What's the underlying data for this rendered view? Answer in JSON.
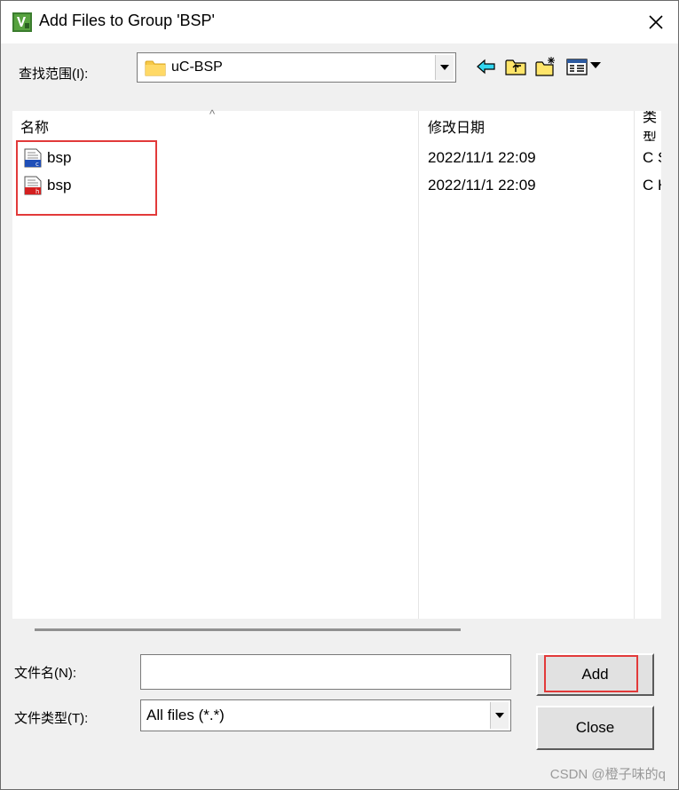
{
  "dialog": {
    "title": "Add Files to Group 'BSP'",
    "app_icon": "keil-uvision-icon",
    "close_icon": "close-icon"
  },
  "lookin": {
    "label": "查找范围(I):",
    "value": "uC-BSP",
    "folder_icon": "folder-icon",
    "toolbar": [
      "back-arrow-icon",
      "up-folder-icon",
      "new-folder-icon",
      "view-menu-icon"
    ]
  },
  "list": {
    "columns": [
      "名称",
      "修改日期",
      "类型"
    ],
    "files": [
      {
        "name": "bsp",
        "date": "2022/11/1 22:09",
        "type": "C Source",
        "icon": "c-source-file-icon"
      },
      {
        "name": "bsp",
        "date": "2022/11/1 22:09",
        "type": "C Header",
        "icon": "c-header-file-icon"
      }
    ]
  },
  "filename": {
    "label": "文件名(N):",
    "value": ""
  },
  "filetype": {
    "label": "文件类型(T):",
    "value": "All files (*.*)"
  },
  "buttons": {
    "add": "Add",
    "close": "Close"
  },
  "annotation_color": "#e23a3a",
  "watermark": "CSDN @橙子味的q"
}
